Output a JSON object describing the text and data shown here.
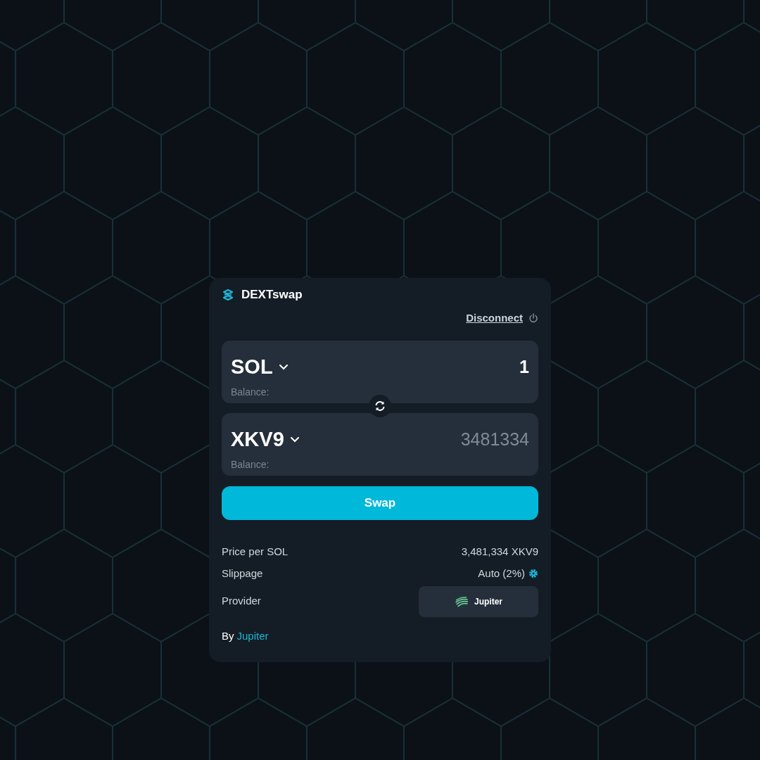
{
  "brand": {
    "name": "DEXTswap"
  },
  "disconnect": {
    "label": "Disconnect"
  },
  "swap_fields": [
    {
      "token": "SOL",
      "amount": "1",
      "balance_label": "Balance:",
      "readonly": false
    },
    {
      "token": "XKV9",
      "amount": "3481334",
      "balance_label": "Balance:",
      "readonly": true
    }
  ],
  "swap_button": {
    "label": "Swap"
  },
  "details": [
    {
      "kind": "text",
      "label": "Price per SOL",
      "value": "3,481,334 XKV9"
    },
    {
      "kind": "setting",
      "label": "Slippage",
      "value": "Auto (2%)"
    },
    {
      "kind": "provider",
      "label": "Provider",
      "value": "Jupiter"
    }
  ],
  "footer": {
    "prefix": "By",
    "link": "Jupiter"
  }
}
